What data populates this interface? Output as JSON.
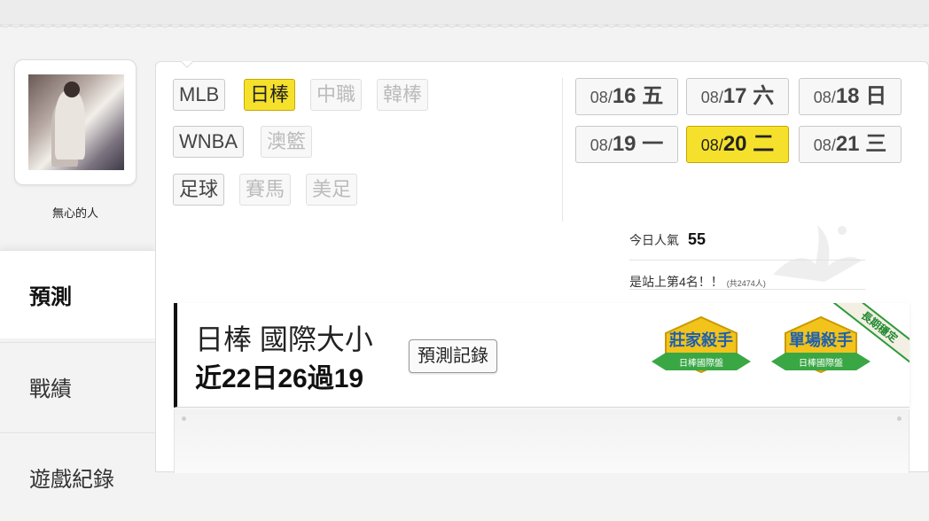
{
  "sidebar": {
    "username": "無心的人",
    "nav": [
      {
        "label": "預測",
        "active": true
      },
      {
        "label": "戰績",
        "active": false
      },
      {
        "label": "遊戲紀錄",
        "active": false
      }
    ]
  },
  "leagues": {
    "row1": [
      {
        "label": "MLB",
        "state": "normal"
      },
      {
        "label": "日棒",
        "state": "selected"
      },
      {
        "label": "中職",
        "state": "disabled"
      },
      {
        "label": "韓棒",
        "state": "disabled"
      }
    ],
    "row2": [
      {
        "label": "WNBA",
        "state": "normal"
      },
      {
        "label": "澳籃",
        "state": "disabled"
      }
    ],
    "row3": [
      {
        "label": "足球",
        "state": "normal"
      },
      {
        "label": "賽馬",
        "state": "disabled"
      },
      {
        "label": "美足",
        "state": "disabled"
      }
    ]
  },
  "dates": [
    {
      "md": "08/",
      "dd": "16 五",
      "selected": false
    },
    {
      "md": "08/",
      "dd": "17 六",
      "selected": false
    },
    {
      "md": "08/",
      "dd": "18 日",
      "selected": false
    },
    {
      "md": "08/",
      "dd": "19 一",
      "selected": false
    },
    {
      "md": "08/",
      "dd": "20 二",
      "selected": true
    },
    {
      "md": "08/",
      "dd": "21 三",
      "selected": false
    }
  ],
  "stats": {
    "popularity_label": "今日人氣",
    "popularity_value": "55",
    "rank_text": "是站上第4名！！",
    "rank_total": "(共2474人)"
  },
  "banner": {
    "title": "日棒 國際大小",
    "record": "近22日26過19",
    "history_button": "預測記錄",
    "badge1_title": "莊家殺手",
    "badge1_sub": "日棒國際盤",
    "badge2_title": "單場殺手",
    "badge2_sub": "日棒國際盤",
    "ribbon": "長期穩定"
  },
  "colors": {
    "accent_yellow": "#f5e12b",
    "badge_green": "#3aa745",
    "badge_gold": "#f2c31b"
  }
}
